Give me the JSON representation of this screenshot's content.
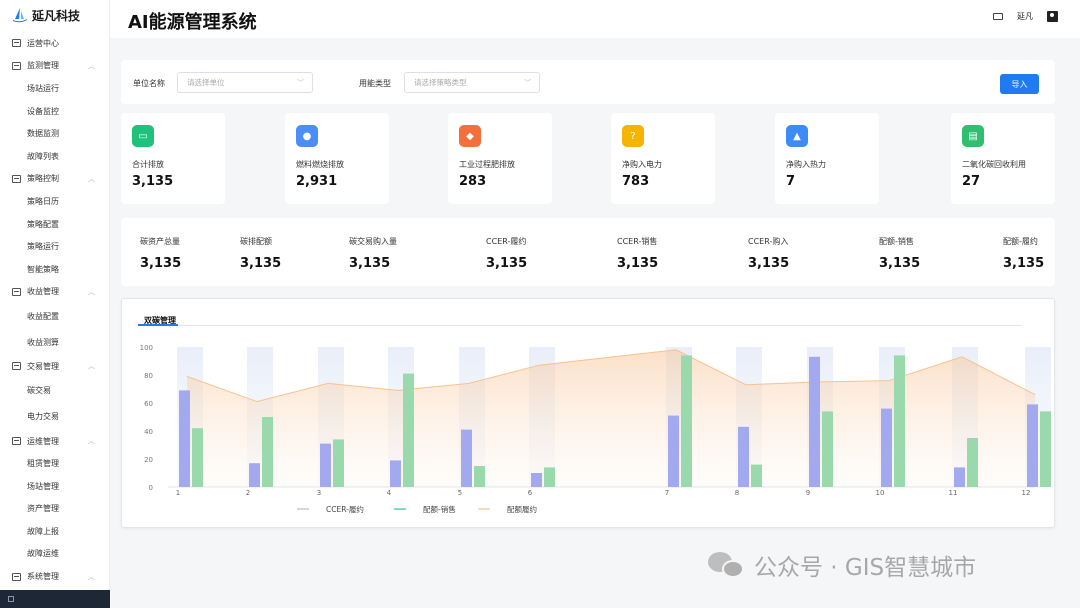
{
  "brand": {
    "name": "延凡科技"
  },
  "header": {
    "title": "AI能源管理系统",
    "user_name": "延凡"
  },
  "sidebar": {
    "items": [
      {
        "label": "运营中心",
        "type": "parent",
        "expandable": false
      },
      {
        "label": "监测管理",
        "type": "parent",
        "expandable": true
      },
      {
        "label": "场站运行",
        "type": "child"
      },
      {
        "label": "设备监控",
        "type": "child"
      },
      {
        "label": "数据监测",
        "type": "child"
      },
      {
        "label": "故障列表",
        "type": "child"
      },
      {
        "label": "策略控制",
        "type": "parent",
        "expandable": true
      },
      {
        "label": "策略日历",
        "type": "child"
      },
      {
        "label": "策略配置",
        "type": "child"
      },
      {
        "label": "策略运行",
        "type": "child"
      },
      {
        "label": "智能策略",
        "type": "child"
      },
      {
        "label": "收益管理",
        "type": "parent",
        "expandable": true
      },
      {
        "label": "收益配置",
        "type": "child",
        "tall": true
      },
      {
        "label": "收益测算",
        "type": "child",
        "tall": true
      },
      {
        "label": "交易管理",
        "type": "parent",
        "expandable": true
      },
      {
        "label": "碳交易",
        "type": "child",
        "tall": true
      },
      {
        "label": "电力交易",
        "type": "child",
        "tall": true
      },
      {
        "label": "运维管理",
        "type": "parent",
        "expandable": true
      },
      {
        "label": "租赁管理",
        "type": "child"
      },
      {
        "label": "场站管理",
        "type": "child"
      },
      {
        "label": "资产管理",
        "type": "child"
      },
      {
        "label": "故障上报",
        "type": "child"
      },
      {
        "label": "故障运维",
        "type": "child"
      },
      {
        "label": "系统管理",
        "type": "parent",
        "expandable": true
      }
    ]
  },
  "filters": {
    "unit_label": "单位名称",
    "unit_placeholder": "请选择单位",
    "energy_label": "用能类型",
    "energy_placeholder": "请选择策略类型",
    "import_button": "导入"
  },
  "stats": [
    {
      "label": "合计排放",
      "value": "3,135",
      "color": "#1fc27a",
      "icon": "screen-icon"
    },
    {
      "label": "燃料燃烧排放",
      "value": "2,931",
      "color": "#4c8ef5",
      "icon": "person-icon"
    },
    {
      "label": "工业过程肥排放",
      "value": "283",
      "color": "#f2703b",
      "icon": "tag-icon"
    },
    {
      "label": "净购入电力",
      "value": "783",
      "color": "#f5b400",
      "icon": "question-icon"
    },
    {
      "label": "净购入热力",
      "value": "7",
      "color": "#3d8bf5",
      "icon": "graduation-icon"
    },
    {
      "label": "二氧化碳回收利用",
      "value": "27",
      "color": "#2fbf6e",
      "icon": "document-icon"
    }
  ],
  "metrics": [
    {
      "label": "碳资产总量",
      "value": "3,135"
    },
    {
      "label": "碳排配额",
      "value": "3,135"
    },
    {
      "label": "碳交易购入量",
      "value": "3,135"
    },
    {
      "label": "CCER-履约",
      "value": "3,135"
    },
    {
      "label": "CCER-销售",
      "value": "3,135"
    },
    {
      "label": "CCER-购入",
      "value": "3,135"
    },
    {
      "label": "配额-销售",
      "value": "3,135"
    },
    {
      "label": "配额-履约",
      "value": "3,135"
    }
  ],
  "chart_tab": "双碳管理",
  "colors": {
    "accent": "#1f7bef",
    "bar1": "#a3a9ee",
    "bar2": "#9ad9ac",
    "line": "#f7c28f"
  },
  "chart_data": {
    "type": "bar",
    "categories": [
      "1",
      "2",
      "3",
      "4",
      "5",
      "6",
      "7",
      "8",
      "9",
      "10",
      "11",
      "12"
    ],
    "ylim": [
      0,
      100
    ],
    "yticks": [
      0,
      20,
      40,
      60,
      80,
      100
    ],
    "series": [
      {
        "name": "CCER-履约",
        "type": "bar",
        "values": [
          69,
          17,
          31,
          19,
          41,
          10,
          51,
          43,
          93,
          56,
          14,
          59
        ]
      },
      {
        "name": "配额-销售",
        "type": "bar",
        "values": [
          42,
          50,
          34,
          81,
          15,
          14,
          94,
          16,
          54,
          94,
          35,
          54
        ]
      },
      {
        "name": "配额履约",
        "type": "area",
        "values": [
          79,
          61,
          74,
          69,
          74,
          87,
          98,
          73,
          75,
          76,
          93,
          66
        ]
      }
    ],
    "legend_position": "bottom"
  }
}
